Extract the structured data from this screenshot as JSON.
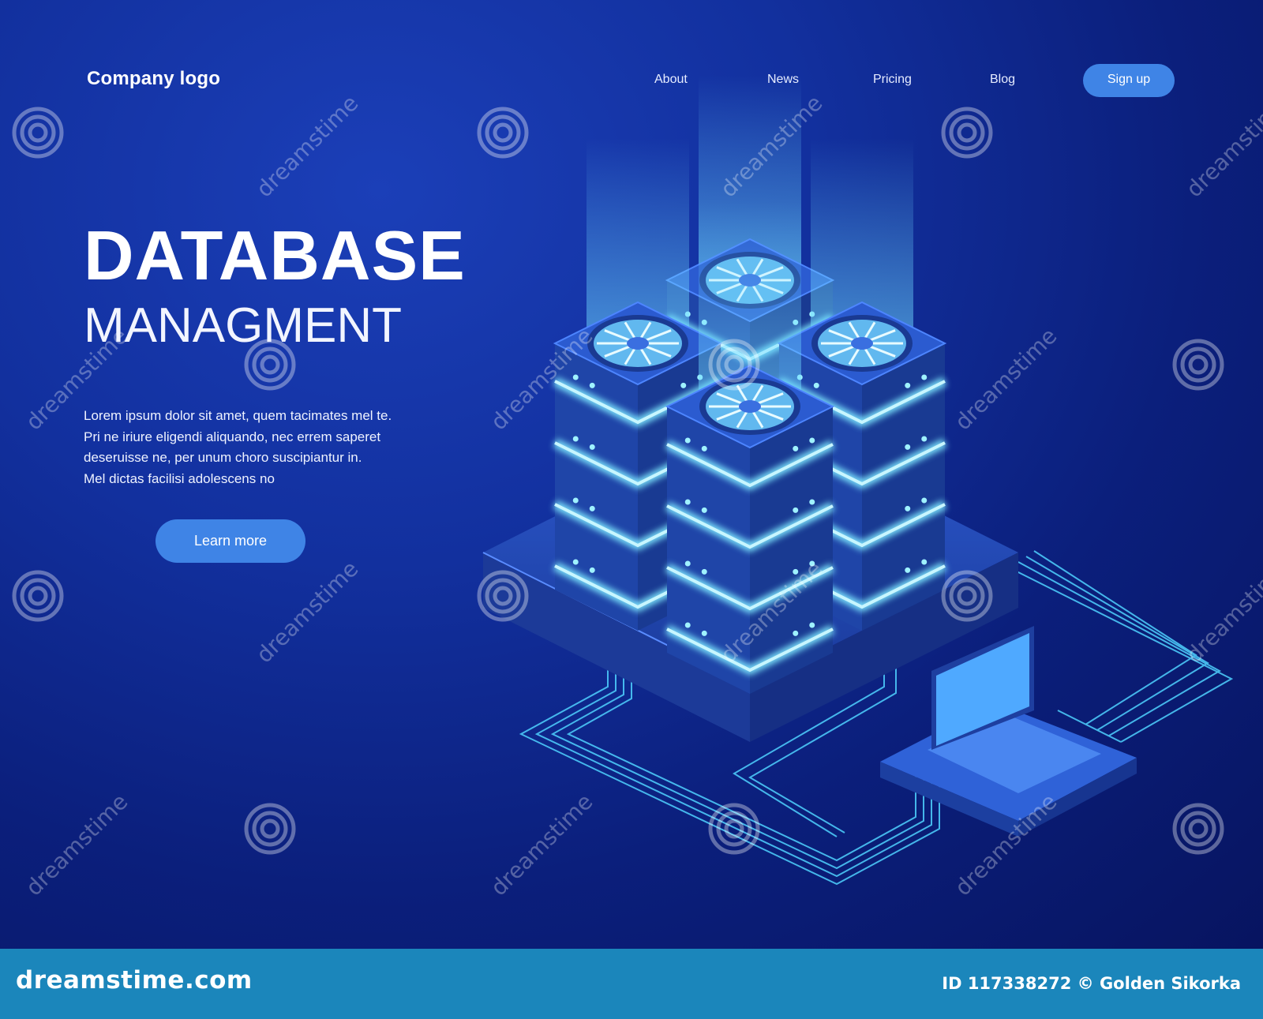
{
  "header": {
    "logo": "Company logo",
    "nav": [
      "About",
      "News",
      "Pricing",
      "Blog"
    ],
    "signup_label": "Sign up"
  },
  "hero": {
    "title": "DATABASE",
    "subtitle": "MANAGMENT",
    "body": [
      "Lorem ipsum dolor sit amet, quem tacimates mel te.",
      "Pri ne iriure eligendi aliquando, nec errem saperet",
      "deseruisse ne, per unum choro suscipiantur in.",
      "Mel dictas facilisi adolescens no"
    ],
    "cta_label": "Learn more"
  },
  "watermark": {
    "text": "dreamstime"
  },
  "footer": {
    "brand": "dreamstime.com",
    "credit": "ID 117338272 © Golden Sikorka"
  },
  "colors": {
    "background": "#0c1f7a",
    "accent_button": "#3f84e6",
    "footer_bar": "#1b86bb",
    "glow": "#7fe8ff"
  },
  "icons": [
    "server-rack-icon",
    "laptop-icon",
    "fan-icon",
    "circuit-lines",
    "watermark-spiral-icon"
  ]
}
